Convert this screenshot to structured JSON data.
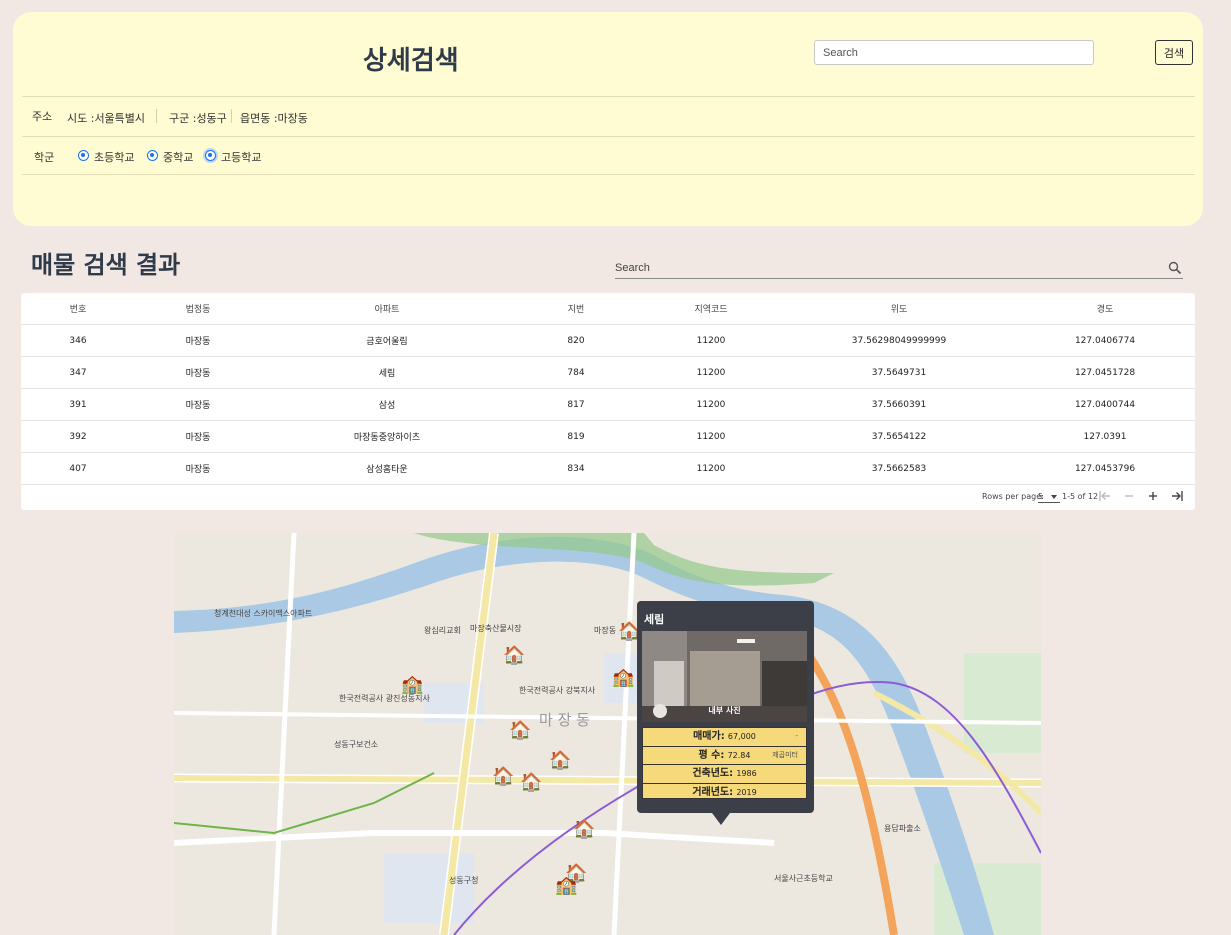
{
  "search_panel": {
    "title": "상세검색",
    "search_placeholder": "Search",
    "search_button": "검색",
    "address_label": "주소",
    "address": {
      "sido": "시도 :서울특별시",
      "gugun": "구군 :성동구",
      "dong": "읍면동 :마장동"
    },
    "school_label": "학군",
    "school_options": [
      "초등학교",
      "중학교",
      "고등학교"
    ]
  },
  "results": {
    "title": "매물 검색 결과",
    "search_placeholder": "Search",
    "columns": [
      "번호",
      "법정동",
      "아파트",
      "지번",
      "지역코드",
      "위도",
      "경도"
    ],
    "rows": [
      [
        "346",
        "마장동",
        "금호어울림",
        "820",
        "11200",
        "37.56298049999999",
        "127.0406774"
      ],
      [
        "347",
        "마장동",
        "세림",
        "784",
        "11200",
        "37.5649731",
        "127.0451728"
      ],
      [
        "391",
        "마장동",
        "삼성",
        "817",
        "11200",
        "37.5660391",
        "127.0400744"
      ],
      [
        "392",
        "마장동",
        "마장동중앙하이츠",
        "819",
        "11200",
        "37.5654122",
        "127.0391"
      ],
      [
        "407",
        "마장동",
        "삼성홈타운",
        "834",
        "11200",
        "37.5662583",
        "127.0453796"
      ]
    ],
    "pagination": {
      "rows_per_page_label": "Rows per page:",
      "rows_per_page_value": "5",
      "range": "1-5 of 12"
    }
  },
  "map": {
    "labels": {
      "district": "마 장 동",
      "l1": "청계천대성 스카이맥스아파트",
      "l2": "한국전력공사 광진성동지사",
      "l3": "마장축산물시장",
      "l4": "성동구청",
      "l5": "성동구보건소",
      "l6": "마장동",
      "l7": "한국전력공사 강북지사",
      "l8": "서울사근초등학교",
      "l9": "왕십리교회",
      "l10": "용답파출소"
    },
    "popup": {
      "title": "세림",
      "photo_caption": "내부 사진",
      "price_label": "매매가:",
      "price": "67,000",
      "price_suffix": "-",
      "area_label": "평 수:",
      "area": "72.84",
      "area_note": "제곱미터",
      "built_label": "건축년도:",
      "built": "1986",
      "deal_label": "거래년도:",
      "deal": "2019"
    }
  },
  "colors": {
    "panel_bg": "#fffbd2",
    "page_bg": "#f1e7e3",
    "title_color": "#2f3b4a",
    "radio_accent": "#1a73e8",
    "popup_bg": "#3c3f48",
    "popup_info_bg": "#f6d97a"
  },
  "icons": {
    "results_search": "search-icon",
    "first_page": "first-page-icon",
    "prev_page": "chevron-left-icon",
    "next_page": "chevron-right-icon",
    "last_page": "last-page-icon",
    "map_marker": "house-icon"
  }
}
